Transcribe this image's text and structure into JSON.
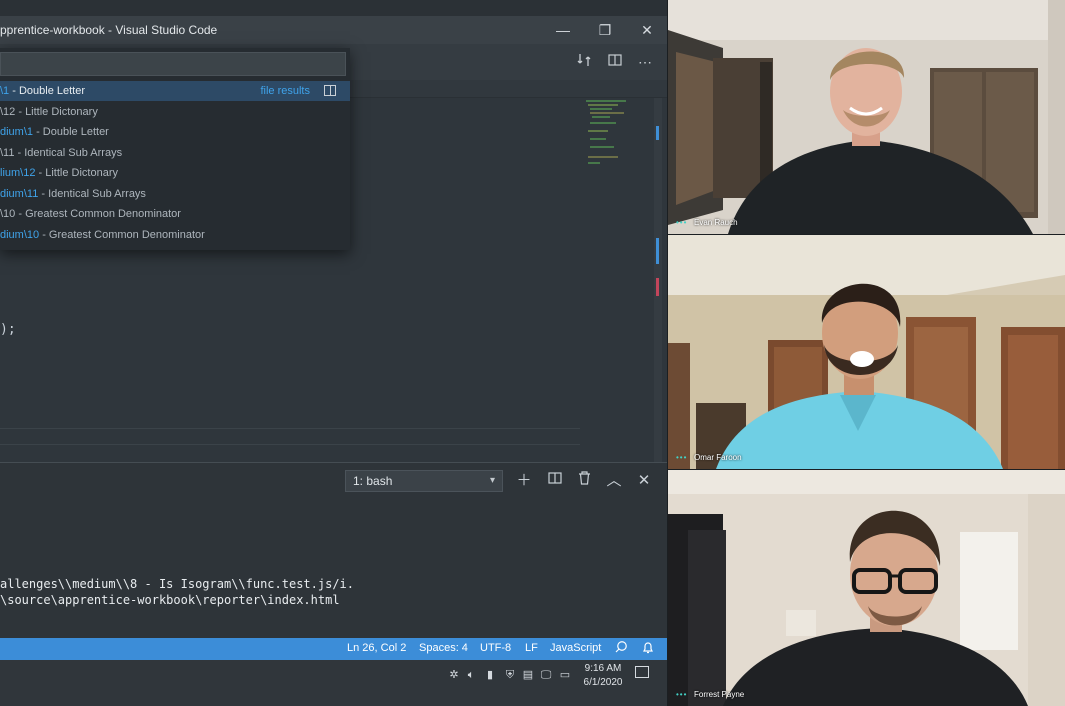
{
  "window": {
    "title": "pprentice-workbook - Visual Studio Code",
    "minimize": "—",
    "restore": "❐",
    "close": "✕"
  },
  "tabbar_icons": [
    "compare-icon",
    "split-editor-icon",
    "more-icon"
  ],
  "quick_open": {
    "input_value": "",
    "file_results_label": "file results",
    "items": [
      {
        "hl": "\\1",
        "rest": " - Double Letter"
      },
      {
        "hl": "",
        "rest": "\\12 - Little Dictonary"
      },
      {
        "hl": "dium\\1",
        "rest": " - Double Letter"
      },
      {
        "hl": "",
        "rest": "\\11 - Identical Sub Arrays"
      },
      {
        "hl": "lium\\12",
        "rest": " - Little Dictonary"
      },
      {
        "hl": "dium\\11",
        "rest": " - Identical Sub Arrays"
      },
      {
        "hl": "",
        "rest": "\\10 - Greatest Common Denominator"
      },
      {
        "hl": "dium\\10",
        "rest": " - Greatest Common Denominator"
      }
    ]
  },
  "editor": {
    "code_fragment": ");"
  },
  "terminal": {
    "selected": "1: bash",
    "lines": [
      "allenges\\\\medium\\\\8 - Is Isogram\\\\func.test.js/i.",
      "\\source\\apprentice-workbook\\reporter\\index.html"
    ]
  },
  "statusbar": {
    "position": "Ln 26, Col 2",
    "spaces": "Spaces: 4",
    "encoding": "UTF-8",
    "eol": "LF",
    "language": "JavaScript"
  },
  "taskbar": {
    "time": "9:16 AM",
    "date": "6/1/2020"
  },
  "participants": [
    {
      "name": "Evan Rauch"
    },
    {
      "name": "Omar Faroon"
    },
    {
      "name": "Forrest Payne"
    }
  ],
  "colors": {
    "accent_blue": "#3c8dd8",
    "highlight_blue": "#3fa3ea",
    "speaker_dots": "#43d1c5"
  }
}
